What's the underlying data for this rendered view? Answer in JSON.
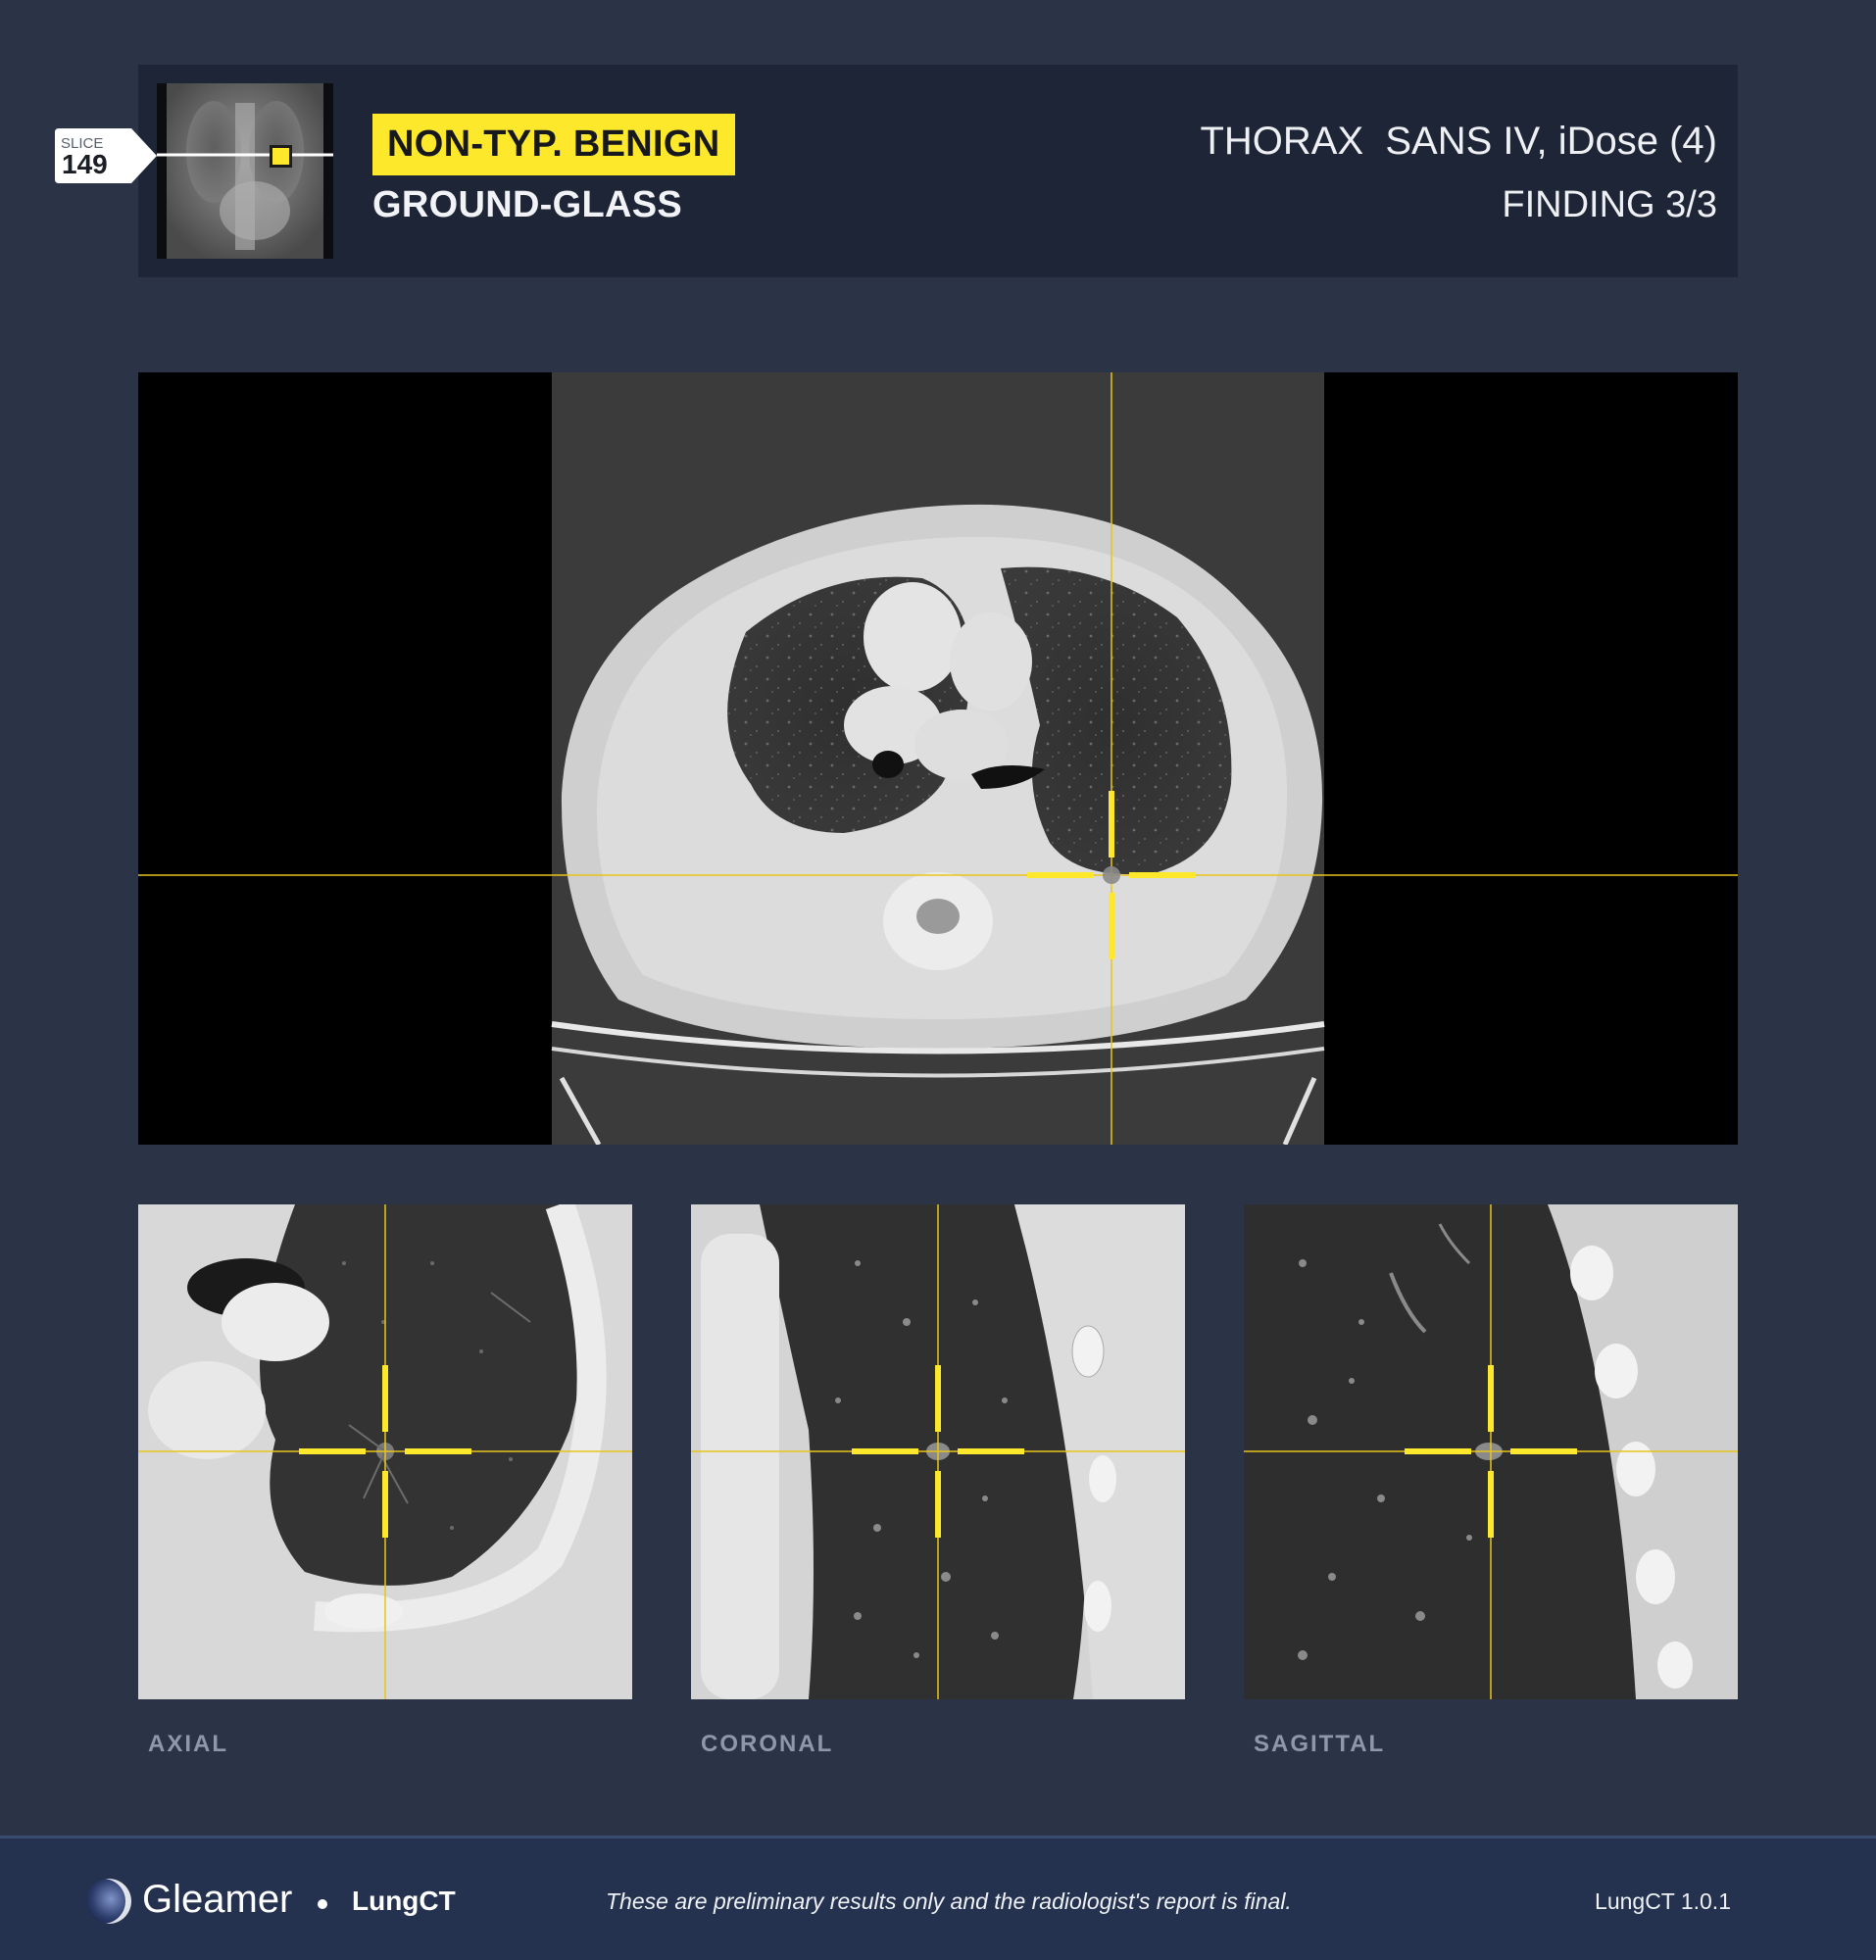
{
  "header": {
    "slice_label": "SLICE",
    "slice_number": "149",
    "classification": "NON-TYP. BENIGN",
    "subtype": "GROUND-GLASS",
    "series": "THORAX  SANS IV, iDose (4)",
    "finding": "FINDING 3/3"
  },
  "views": {
    "axial_label": "AXIAL",
    "coronal_label": "CORONAL",
    "sagittal_label": "SAGITTAL"
  },
  "footer": {
    "brand": "Gleamer",
    "product": "LungCT",
    "disclaimer": "These are preliminary results only and the radiologist's report is final.",
    "version": "LungCT 1.0.1"
  },
  "colors": {
    "accent": "#fde82c",
    "background": "#2b3446",
    "header_bg": "#1d2536",
    "footer_bg": "#24324f"
  },
  "icons": {
    "logo": "gleamer-logo-icon",
    "crosshair": "crosshair-marker-icon",
    "slice_marker": "slice-position-marker-icon"
  }
}
